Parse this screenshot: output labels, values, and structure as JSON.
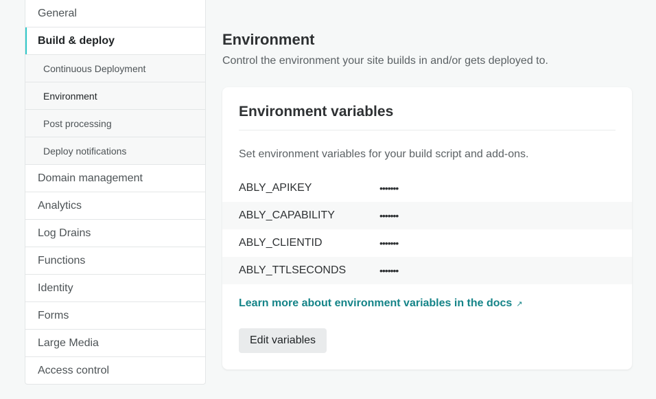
{
  "sidebar": {
    "items": [
      {
        "label": "General"
      },
      {
        "label": "Build & deploy"
      },
      {
        "label": "Continuous Deployment"
      },
      {
        "label": "Environment"
      },
      {
        "label": "Post processing"
      },
      {
        "label": "Deploy notifications"
      },
      {
        "label": "Domain management"
      },
      {
        "label": "Analytics"
      },
      {
        "label": "Log Drains"
      },
      {
        "label": "Functions"
      },
      {
        "label": "Identity"
      },
      {
        "label": "Forms"
      },
      {
        "label": "Large Media"
      },
      {
        "label": "Access control"
      }
    ]
  },
  "main": {
    "title": "Environment",
    "description": "Control the environment your site builds in and/or gets deployed to."
  },
  "card": {
    "title": "Environment variables",
    "description": "Set environment variables for your build script and add-ons.",
    "variables": [
      {
        "key": "ABLY_APIKEY",
        "value": "•••••••"
      },
      {
        "key": "ABLY_CAPABILITY",
        "value": "•••••••"
      },
      {
        "key": "ABLY_CLIENTID",
        "value": "•••••••"
      },
      {
        "key": "ABLY_TTLSECONDS",
        "value": "•••••••"
      }
    ],
    "docs_link": "Learn more about environment variables in the docs",
    "docs_link_icon": "external-link-icon",
    "docs_link_glyph": "↗",
    "edit_button": "Edit variables"
  },
  "colors": {
    "accent": "#30c8c9",
    "link": "#158488",
    "background": "#f6f8f8"
  }
}
